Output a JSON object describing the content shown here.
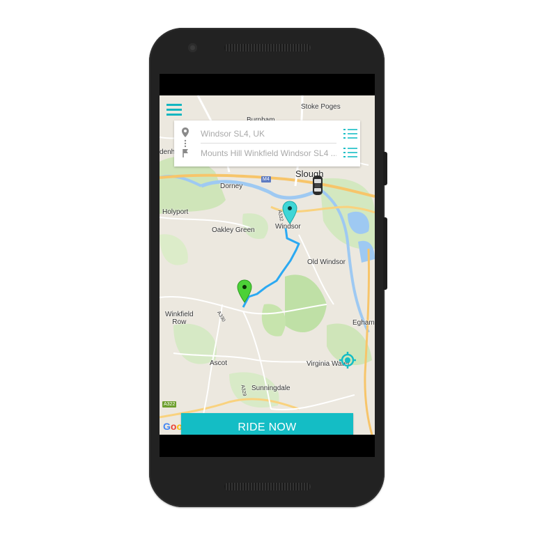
{
  "map": {
    "places": [
      {
        "id": "stoke-poges",
        "label": "Stoke Poges"
      },
      {
        "id": "slough",
        "label": "Slough"
      },
      {
        "id": "dorney",
        "label": "Dorney"
      },
      {
        "id": "holyport",
        "label": "Holyport"
      },
      {
        "id": "windsor",
        "label": "Windsor"
      },
      {
        "id": "oakley-green",
        "label": "Oakley Green"
      },
      {
        "id": "old-windsor",
        "label": "Old Windsor"
      },
      {
        "id": "winkfield-row",
        "label": "Winkfield\nRow"
      },
      {
        "id": "egham",
        "label": "Egham"
      },
      {
        "id": "ascot",
        "label": "Ascot"
      },
      {
        "id": "virginia-water",
        "label": "Virginia Water"
      },
      {
        "id": "sunningdale",
        "label": "Sunningdale"
      },
      {
        "id": "burnham",
        "label": "Burnham"
      },
      {
        "id": "maidenhead",
        "label": "denh"
      }
    ],
    "shields": {
      "m4": "M4",
      "a332": "A332",
      "a322": "A322",
      "a330": "A330",
      "a329": "A329"
    },
    "google_label": "Google"
  },
  "search": {
    "pickup": "Windsor SL4, UK",
    "dropoff": "Mounts Hill Winkfield Windsor SL4 ..."
  },
  "ride_button_label": "Ride now",
  "colors": {
    "accent": "#14bdc5",
    "route": "#2ba9f2",
    "origin_pin": "#4cd137",
    "destination_pin": "#3fd6d6"
  },
  "icons": {
    "menu": "hamburger-icon",
    "pickup": "location-pin-icon",
    "dropoff": "flag-icon",
    "list": "list-icon",
    "car": "car-icon",
    "locate": "locate-crosshair-icon"
  }
}
